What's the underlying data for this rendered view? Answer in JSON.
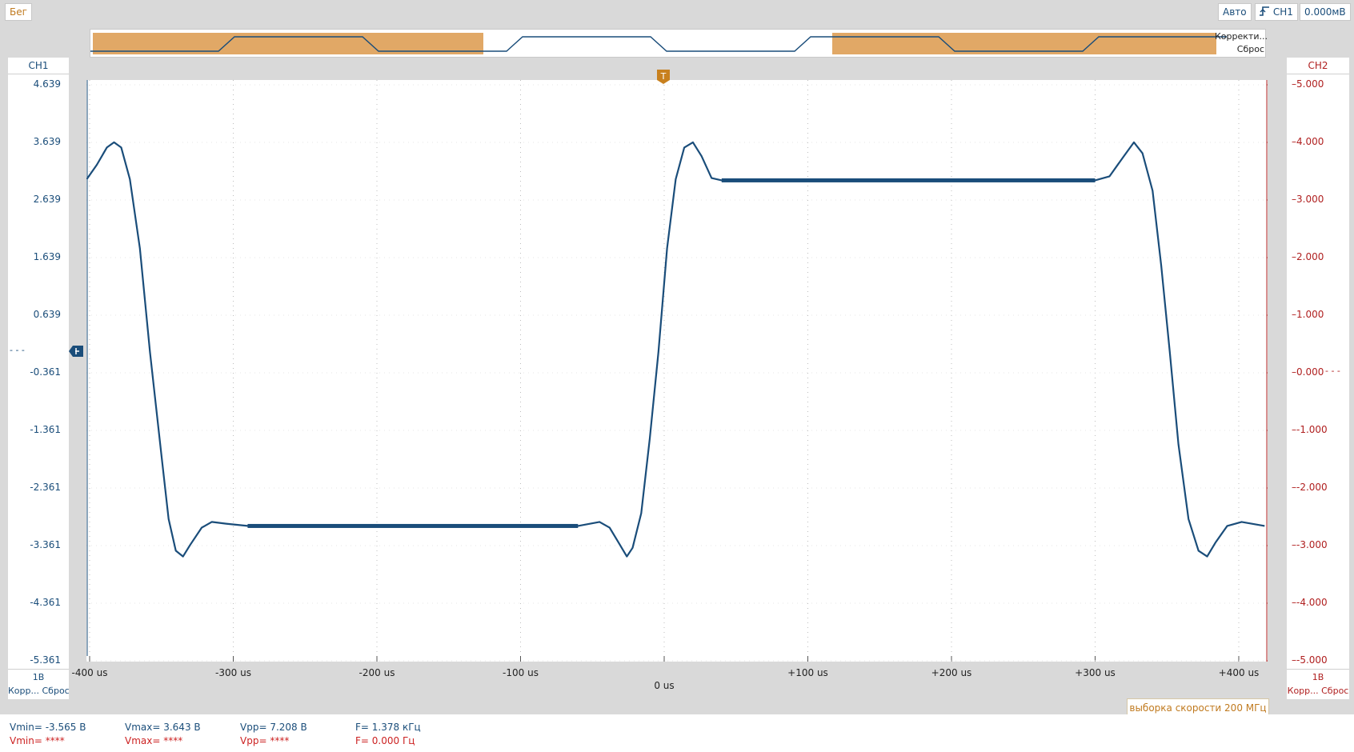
{
  "toolbar": {
    "run_label": "Бег",
    "trigger_mode_label": "Авто",
    "trigger_source_label": "CH1",
    "trigger_level_label": "0.000мВ"
  },
  "overview": {
    "correct_label": "Корректи...",
    "reset_label": "Сброс",
    "trigger_marker": "T"
  },
  "ch1": {
    "name": "CH1",
    "scale": "1В",
    "links": "Корр... Сброс",
    "ticks": [
      "4.639",
      "3.639",
      "2.639",
      "1.639",
      "0.639",
      "-0.361",
      "-1.361",
      "-2.361",
      "-3.361",
      "-4.361",
      "-5.361"
    ],
    "level_marker": "- - -",
    "color": "#1a4d7a"
  },
  "ch2": {
    "name": "CH2",
    "scale": "1В",
    "links": "Корр... Сброс",
    "ticks": [
      "5.000",
      "4.000",
      "3.000",
      "2.000",
      "1.000",
      "0.000",
      "-1.000",
      "-2.000",
      "-3.000",
      "-4.000",
      "-5.000"
    ],
    "level_marker": "- - -",
    "color": "#b02020"
  },
  "time_axis": {
    "ticks": [
      "-400 us",
      "-300 us",
      "-200 us",
      "-100 us",
      "0 us",
      "+100 us",
      "+200 us",
      "+300 us",
      "+400 us"
    ],
    "trigger_marker": "T"
  },
  "sample_rate": "выборка скорости 200 МГц",
  "measurements": {
    "ch1": {
      "vmin": "Vmin= -3.565 В",
      "vmax": "Vmax= 3.643 В",
      "vpp": "Vpp= 7.208 В",
      "freq": "F= 1.378 кГц"
    },
    "ch2": {
      "vmin": "Vmin= ****",
      "vmax": "Vmax= ****",
      "vpp": "Vpp= ****",
      "freq": "F= 0.000 Гц"
    }
  }
}
